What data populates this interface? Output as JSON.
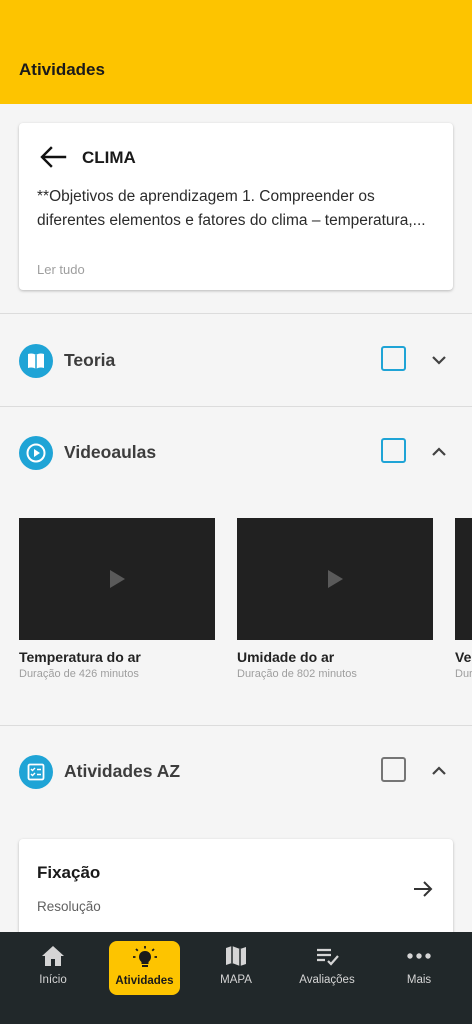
{
  "appbar": {
    "title": "Atividades"
  },
  "topic": {
    "title": "CLIMA",
    "description": "**Objetivos de aprendizagem  1. Compreender os diferentes elementos e fatores do clima – temperatura,...",
    "read_all": "Ler tudo"
  },
  "sections": {
    "teoria": {
      "label": "Teoria",
      "checked": false,
      "expanded": false
    },
    "videoaulas": {
      "label": "Videoaulas",
      "checked": false,
      "expanded": true
    },
    "atividades_az": {
      "label": "Atividades AZ",
      "checked": false,
      "expanded": true
    }
  },
  "videos": [
    {
      "title": "Temperatura do ar",
      "duration": "Duração de 426 minutos"
    },
    {
      "title": "Umidade do ar",
      "duration": "Duração de 802 minutos"
    },
    {
      "title": "Ve",
      "duration": "Dur"
    }
  ],
  "activity": {
    "title": "Fixação",
    "subtitle": "Resolução"
  },
  "nav": {
    "items": [
      {
        "label": "Início",
        "icon": "home-icon"
      },
      {
        "label": "Atividades",
        "icon": "lightbulb-icon",
        "active": true
      },
      {
        "label": "MAPA",
        "icon": "map-icon"
      },
      {
        "label": "Avaliações",
        "icon": "checklist-icon"
      },
      {
        "label": "Mais",
        "icon": "more-icon"
      }
    ]
  },
  "colors": {
    "accent": "#fdc400",
    "section_icon": "#1fa4d6",
    "nav_bg": "#21282a"
  }
}
